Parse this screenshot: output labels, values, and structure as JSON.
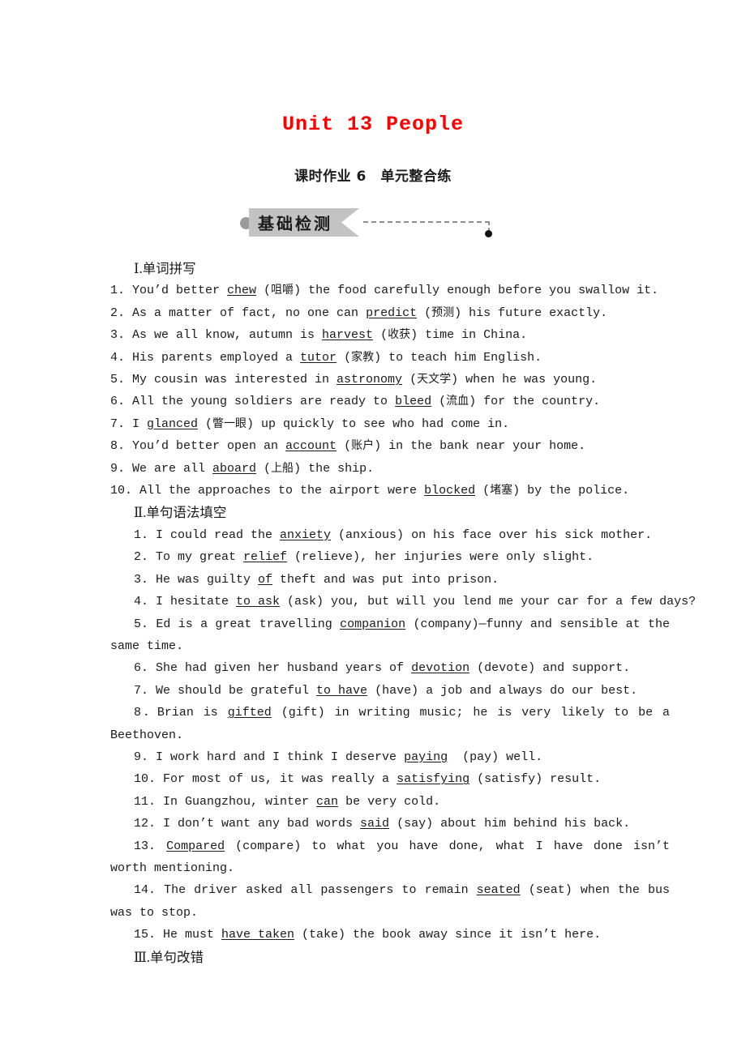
{
  "header": {
    "unit_title": "Unit 13 People",
    "sub_title": "课时作业 6　单元整合练",
    "banner_label": "基础检测"
  },
  "sections": [
    {
      "heading": "Ⅰ.单词拼写",
      "items": [
        "1. You’d better chew (咀嚼) the food carefully enough before you swallow it.",
        "2. As a matter of fact, no one can predict (预测) his future exactly.",
        "3. As we all know, autumn is harvest (收获) time in China.",
        "4. His parents employed a tutor (家教) to teach him English.",
        "5. My cousin was interested in astronomy (天文学) when he was young.",
        "6. All the young soldiers are ready to bleed (流血) for the country.",
        "7. I glanced (瞥一眼) up quickly to see who had come in.",
        "8. You’d better open an account (账户) in the bank near your home.",
        "9. We are all aboard (上船) the ship.",
        "10. All the approaches to the airport were blocked (堵塞) by the police."
      ]
    },
    {
      "heading": "Ⅱ.单句语法填空",
      "items": [
        "1. I could read the anxiety (anxious) on his face over his sick mother.",
        "2. To my great relief (relieve), her injuries were only slight.",
        "3. He was guilty of theft and was put into prison.",
        "4. I hesitate to ask (ask) you, but will you lend me your car for a few days?",
        "5. Ed is a great travelling companion (company)—funny and sensible at the same time.",
        "6. She had given her husband years of devotion (devote) and support.",
        "7. We should be grateful to have (have) a job and always do our best.",
        "8．Brian is gifted (gift) in writing music; he is very likely to be a Beethoven.",
        "9. I work hard and I think I deserve paying  (pay) well.",
        "10. For most of us, it was really a satisfying (satisfy) result.",
        "11. In Guangzhou, winter can be very cold.",
        "12. I don’t want any bad words said (say) about him behind his back.",
        "13. Compared (compare) to what you have done, what I have done isn’t worth mentioning.",
        "14. The driver asked all passengers to remain seated (seat) when the bus was to stop.",
        "15. He must have taken (take) the book away since it isn’t here."
      ]
    },
    {
      "heading": "Ⅲ.单句改错",
      "items": []
    }
  ],
  "answers": {
    "spelling": [
      "chew",
      "predict",
      "harvest",
      "tutor",
      "astronomy",
      "bleed",
      "glanced",
      "account",
      "aboard",
      "blocked"
    ],
    "grammar": [
      "anxiety",
      "relief",
      "of",
      "to ask",
      "companion",
      "devotion",
      "to have",
      "gifted",
      "paying",
      "satisfying",
      "can",
      "said",
      "Compared",
      "seated",
      "have taken"
    ]
  },
  "colors": {
    "title_red": "#fe0000",
    "banner_grey": "#c3c3c3",
    "text_black": "#1a1a1a"
  }
}
